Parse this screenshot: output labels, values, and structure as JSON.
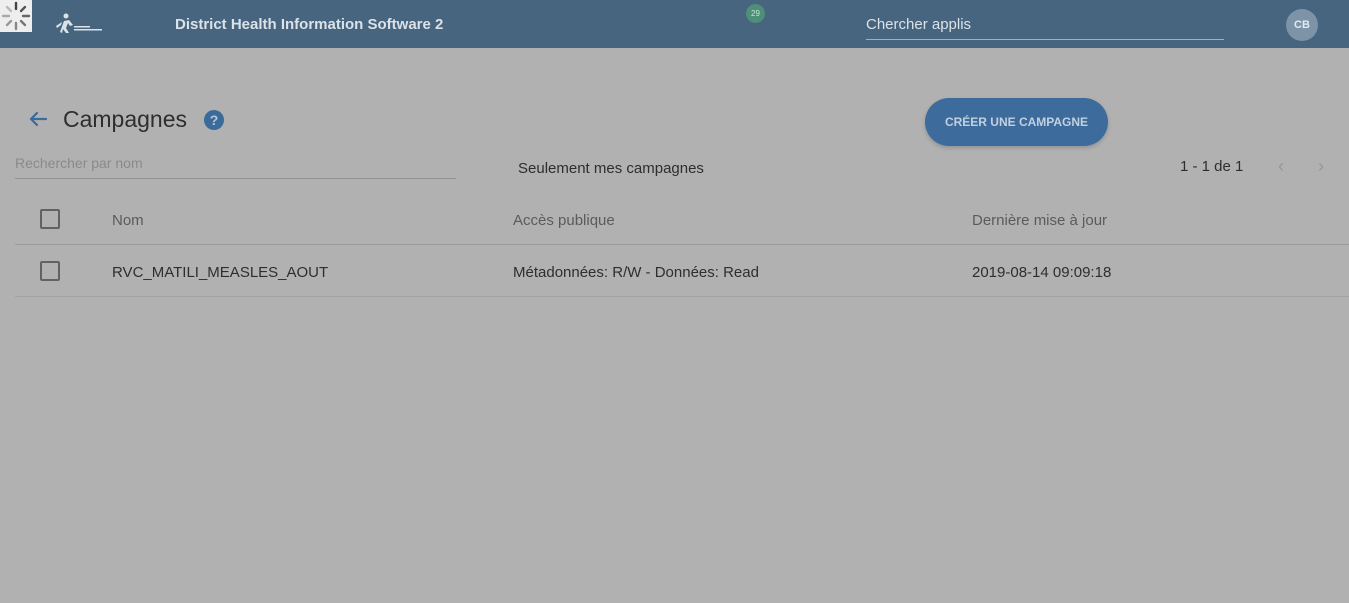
{
  "header": {
    "app_title": "District Health Information Software 2",
    "notification_count": "29",
    "app_search_placeholder": "Chercher applis",
    "user_initials": "CB"
  },
  "page": {
    "title": "Campagnes",
    "help_label": "?",
    "create_button_label": "CRÉER UNE CAMPAGNE"
  },
  "filters": {
    "search_placeholder": "Rechercher par nom",
    "only_mine_label": "Seulement mes campagnes"
  },
  "pagination": {
    "range_text": "1 - 1 de 1",
    "prev_icon": "‹",
    "next_icon": "›"
  },
  "table": {
    "columns": [
      "Nom",
      "Accès publique",
      "Dernière mise à jour"
    ],
    "rows": [
      {
        "name": "RVC_MATILI_MEASLES_AOUT",
        "public_access": "Métadonnées: R/W - Données: Read",
        "last_updated": "2019-08-14 09:09:18",
        "selected": false
      }
    ]
  },
  "colors": {
    "topbar": "#47657f",
    "background": "#b1b1b1",
    "accent": "#3c6b9c"
  }
}
